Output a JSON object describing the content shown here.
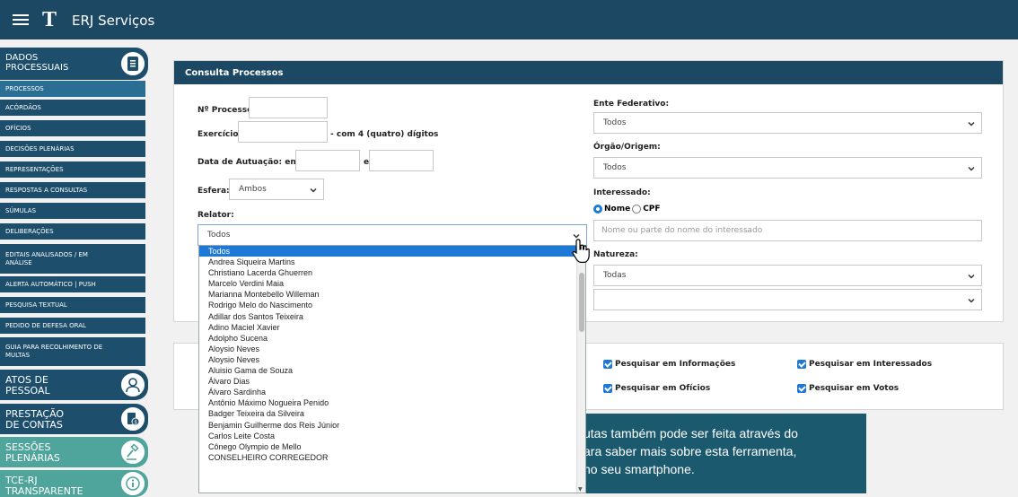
{
  "header": {
    "logo": "T",
    "logo_text": "ERJ Serviços"
  },
  "sidebar": {
    "sections": [
      {
        "label": "DADOS PROCESSUAIS",
        "icon": "document-icon"
      },
      {
        "label": "ATOS DE PESSOAL",
        "icon": "user-icon"
      },
      {
        "label": "PRESTAÇÃO DE CONTAS",
        "icon": "money-icon"
      },
      {
        "label": "SESSÕES PLENÁRIAS",
        "icon": "gavel-icon"
      },
      {
        "label": "TCE-RJ TRANSPARENTE",
        "icon": "info-icon"
      }
    ],
    "items": [
      "PROCESSOS",
      "ACÓRDÃOS",
      "OFÍCIOS",
      "DECISÕES PLENÁRIAS",
      "REPRESENTAÇÕES",
      "RESPOSTAS A CONSULTAS",
      "SÚMULAS",
      "DELIBERAÇÕES",
      "EDITAIS ANALISADOS / EM ANÁLISE",
      "ALERTA AUTOMÁTICO | PUSH",
      "PESQUISA TEXTUAL",
      "PEDIDO DE DEFESA ORAL",
      "GUIA PARA RECOLHIMENTO DE MULTAS"
    ]
  },
  "form": {
    "title": "Consulta Processos",
    "processo_label": "Nº Processo:",
    "exercicio_label": "Exercício:",
    "exercicio_hint": "- com 4 (quatro) dígitos",
    "data_label": "Data de Autuação: entre",
    "data_e": "e",
    "esfera_label": "Esfera:",
    "esfera_value": "Ambos",
    "relator_label": "Relator:",
    "relator_value": "Todos",
    "ente_label": "Ente Federativo:",
    "ente_value": "Todos",
    "orgao_label": "Órgão/Origem:",
    "orgao_value": "Todos",
    "interessado_label": "Interessado:",
    "radio_nome": "Nome",
    "radio_cpf": "CPF",
    "interessado_placeholder": "Nome ou parte do nome do interessado",
    "natureza_label": "Natureza:",
    "natureza_value": "Todas"
  },
  "relator_options": [
    "Todos",
    "Andrea Siqueira Martins",
    "Christiano Lacerda Ghuerren",
    "Marcelo Verdini Maia",
    "Marianna Montebello Willeman",
    "Rodrigo Melo do Nascimento",
    "Adillar dos Santos Teixeira",
    "Adino Maciel Xavier",
    "Adolpho Sucena",
    "Aloysio Neves",
    "Aloysio Neves",
    "Aluisio Gama de Souza",
    "Álvaro Dias",
    "Álvaro Sardinha",
    "Antônio Máximo Nogueira Penido",
    "Badger Teixeira da Silveira",
    "Benjamin Guilherme dos Reis Júnior",
    "Carlos Leite Costa",
    "Cônego Olympio de Mello",
    "CONSELHEIRO CORREGEDOR"
  ],
  "checkboxes": {
    "informacoes": "Pesquisar em Informações",
    "interessados": "Pesquisar em Interessados",
    "oficios": "Pesquisar em Ofícios",
    "votos": "Pesquisar em Votos"
  },
  "banner": {
    "line1": "utas também pode ser feita através do",
    "line2": "ara saber mais sobre esta ferramenta,",
    "line3": "no seu smartphone."
  },
  "colors": {
    "header": "#1c4863",
    "sidebar": "#1d4e6b",
    "sidebar_green": "#4fa59b",
    "accent": "#1e79d6"
  }
}
